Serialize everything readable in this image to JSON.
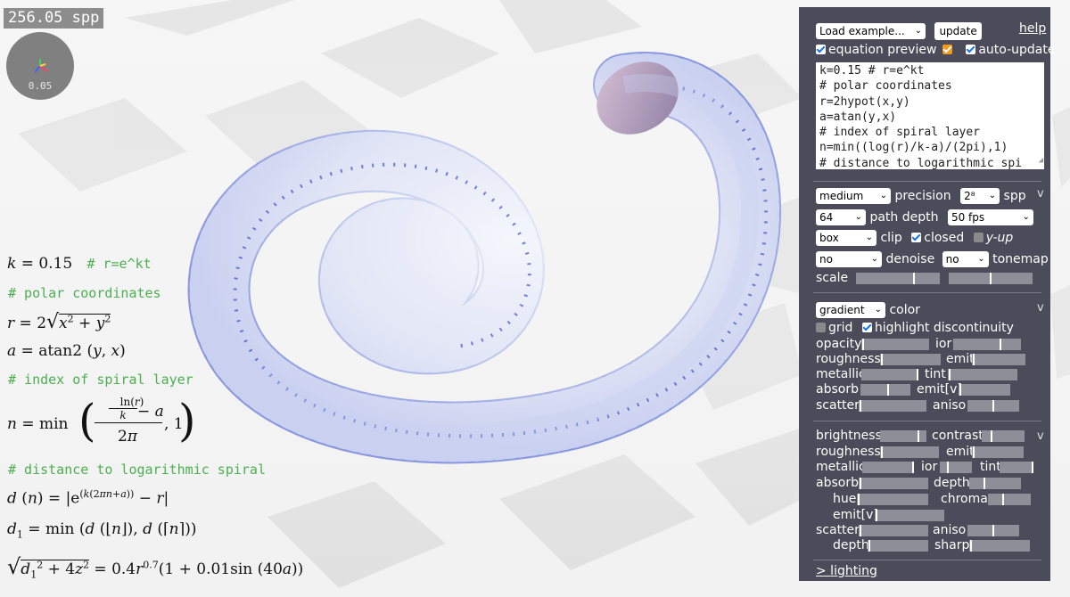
{
  "status": {
    "spp_readout": "256.05 spp",
    "gizmo_value": "0.05"
  },
  "equations": {
    "line1_comment": "# r=e^kt",
    "comment2": "# polar coordinates",
    "comment3": "# index of spiral layer",
    "comment4": "# distance to logarithmic spiral"
  },
  "panel": {
    "load_example": "Load example...",
    "update": "update",
    "help": "help",
    "equation_preview": "equation preview",
    "auto_update": "auto-update",
    "code": "k=0.15 # r=e^kt\n# polar coordinates\nr=2hypot(x,y)\na=atan(y,x)\n# index of spiral layer\nn=min((log(r)/k-a)/(2pi),1)\n# distance to logarithmic spi",
    "render": {
      "quality": "medium",
      "precision_label": "precision",
      "spp_select": "2⁸",
      "spp_label": "spp",
      "collapse": "v",
      "path_depth_value": "64",
      "path_depth_label": "path depth",
      "fps": "50 fps",
      "clip_value": "box",
      "clip_label": "clip",
      "closed_label": "closed",
      "yup_label": "y-up",
      "denoise_value": "no",
      "denoise_label": "denoise",
      "tonemap_value": "no",
      "tonemap_label": "tonemap",
      "scale_label": "scale"
    },
    "material": {
      "color_mode": "gradient",
      "color_label": "color",
      "collapse": "v",
      "grid_label": "grid",
      "highlight_label": "highlight discontinuity",
      "opacity": "opacity",
      "ior": "ior",
      "roughness": "roughness",
      "emit": "emit",
      "metallic": "metallic",
      "tint": "tint",
      "absorb": "absorb",
      "emitv": "emit[v]",
      "scatter": "scatter",
      "aniso": "aniso"
    },
    "background": {
      "brightness": "brightness",
      "contrast": "contrast",
      "collapse": "v",
      "roughness": "roughness",
      "emit": "emit",
      "metallic": "metallic",
      "ior": "ior",
      "tint": "tint",
      "absorb": "absorb",
      "depth": "depth",
      "hue": "hue",
      "chroma": "chroma",
      "emitv": "emit[v]",
      "scatter": "scatter",
      "aniso": "aniso",
      "depth2": "depth",
      "sharp": "sharp"
    },
    "lighting_link": "> lighting"
  }
}
